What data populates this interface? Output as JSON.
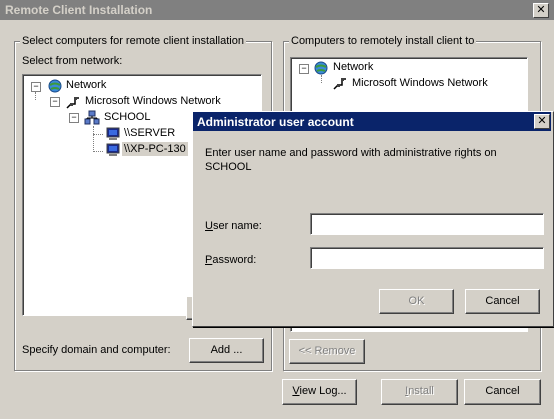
{
  "window": {
    "title": "Remote Client Installation",
    "close": "✕"
  },
  "left_group": {
    "label": "Select computers for remote client installation",
    "sublabel": "Select from network:",
    "tree": {
      "network": "Network",
      "ms_network": "Microsoft Windows Network",
      "domain": "SCHOOL",
      "pc1": "\\\\SERVER",
      "pc2": "\\\\XP-PC-130"
    },
    "specify_label": "Specify domain and computer:",
    "add_button": "Add ..."
  },
  "right_group": {
    "label": "Computers to remotely install client to",
    "tree": {
      "network": "Network",
      "ms_network": "Microsoft Windows Network"
    },
    "remove_button": "<< Remove"
  },
  "footer": {
    "view_log": "View Log...",
    "install": "Install",
    "cancel": "Cancel"
  },
  "dialog": {
    "title": "Administrator user account",
    "close": "✕",
    "message": "Enter user name and password with administrative rights on SCHOOL",
    "username_label": "User name:",
    "username_value": "",
    "password_label": "Password:",
    "password_value": "",
    "ok": "OK",
    "cancel": "Cancel"
  }
}
